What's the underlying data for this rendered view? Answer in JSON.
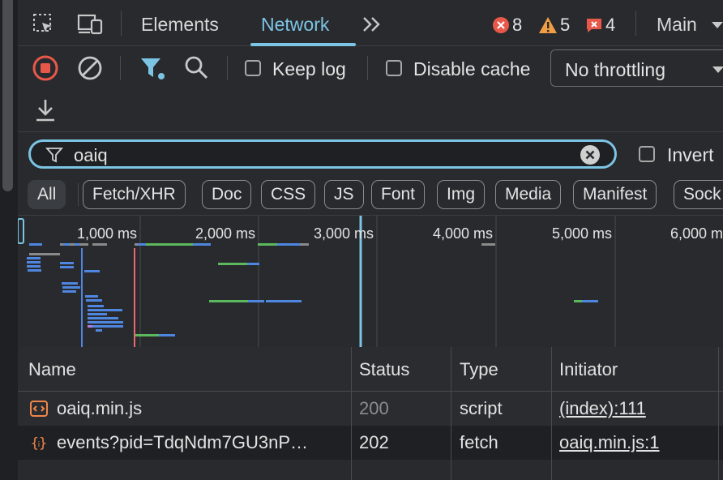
{
  "tabs": {
    "elements": "Elements",
    "network": "Network"
  },
  "status": {
    "errors": "8",
    "warnings": "5",
    "issues": "4",
    "context": "Main"
  },
  "toolbar": {
    "keep_log": "Keep log",
    "disable_cache": "Disable cache",
    "throttling": "No throttling"
  },
  "filter": {
    "value": "oaiq",
    "invert": "Invert"
  },
  "types": [
    "All",
    "Fetch/XHR",
    "Doc",
    "CSS",
    "JS",
    "Font",
    "Img",
    "Media",
    "Manifest",
    "Sock"
  ],
  "timeline": {
    "ticks": [
      "1,000 ms",
      "2,000 ms",
      "3,000 ms",
      "4,000 ms",
      "5,000 ms",
      "6,000 ms"
    ]
  },
  "table": {
    "headers": [
      "Name",
      "Status",
      "Type",
      "Initiator"
    ],
    "rows": [
      {
        "name": "oaiq.min.js",
        "status": "200",
        "type": "script",
        "initiator": "(index):111"
      },
      {
        "name": "events?pid=TdqNdm7GU3nP…",
        "status": "202",
        "type": "fetch",
        "initiator": "oaiq.min.js:1"
      }
    ]
  },
  "colors": {
    "accent": "#7cc4e4",
    "error": "#e8584a",
    "warning": "#f09d44",
    "bar_blue": "#4f86e0",
    "bar_green": "#5cb85c",
    "bar_gray": "#8a8a8a"
  }
}
